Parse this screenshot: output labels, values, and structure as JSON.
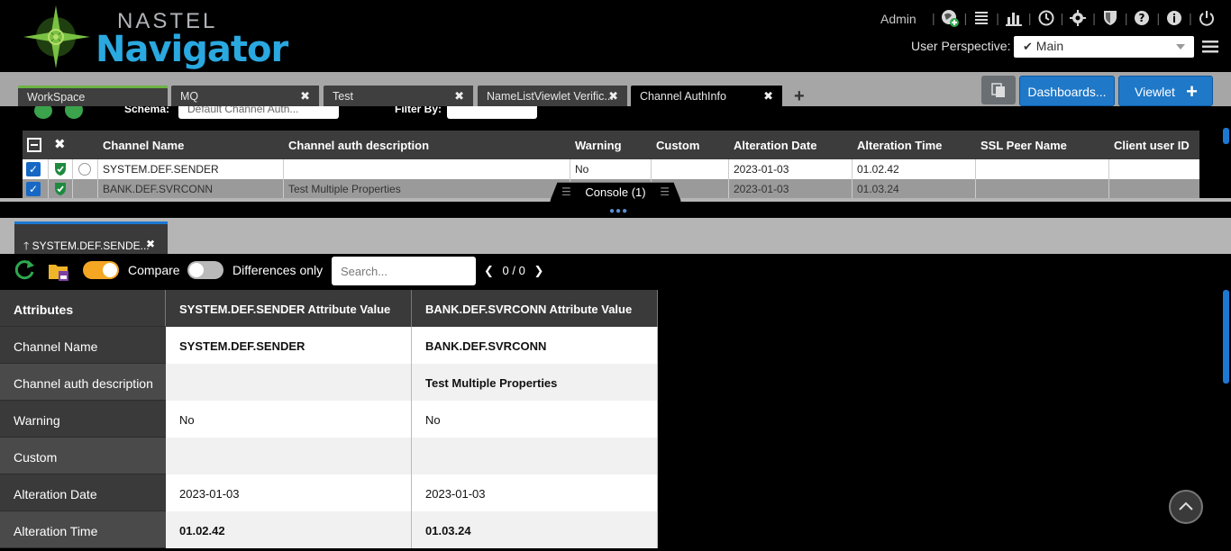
{
  "header": {
    "logo_top": "NASTEL",
    "logo_bottom": "Navigator",
    "user": "Admin",
    "perspective_label": "User Perspective:",
    "perspective_value": "Main",
    "icons": [
      "globe-add-icon",
      "list-icon",
      "bar-chart-icon",
      "clock-icon",
      "gear-icon",
      "shield-icon",
      "help-icon",
      "info-icon",
      "power-icon"
    ]
  },
  "tabs": [
    {
      "label": "WorkSpace"
    },
    {
      "label": "MQ"
    },
    {
      "label": "Test"
    },
    {
      "label": "NameListViewlet Verific..."
    },
    {
      "label": "Channel AuthInfo"
    }
  ],
  "toolbar_buttons": {
    "dashboards": "Dashboards...",
    "viewlet": "Viewlet"
  },
  "upper_toolbar": {
    "schema_label": "Schema:",
    "schema_value": "Default Channel Auth...",
    "filter_label": "Filter By:"
  },
  "grid": {
    "columns": [
      "Channel Name",
      "Channel auth description",
      "Warning",
      "Custom",
      "Alteration Date",
      "Alteration Time",
      "SSL Peer Name",
      "Client user ID"
    ],
    "rows": [
      {
        "channel_name": "SYSTEM.DEF.SENDER",
        "description": "",
        "warning": "No",
        "custom": "",
        "alt_date": "2023-01-03",
        "alt_time": "01.02.42",
        "ssl_peer": "",
        "client_user": ""
      },
      {
        "channel_name": "BANK.DEF.SVRCONN",
        "description": "Test Multiple Properties",
        "warning": "",
        "custom": "",
        "alt_date": "2023-01-03",
        "alt_time": "01.03.24",
        "ssl_peer": "",
        "client_user": ""
      }
    ]
  },
  "console": {
    "label": "Console (1)"
  },
  "compare": {
    "tab_label": "SYSTEM.DEF.SENDE...",
    "compare_label": "Compare",
    "diff_label": "Differences only",
    "search_placeholder": "Search...",
    "pager": "0 / 0",
    "headers": [
      "Attributes",
      "SYSTEM.DEF.SENDER Attribute Value",
      "BANK.DEF.SVRCONN Attribute Value"
    ],
    "rows": [
      {
        "attr": "Channel Name",
        "v1": "SYSTEM.DEF.SENDER",
        "v2": "BANK.DEF.SVRCONN",
        "diff": true
      },
      {
        "attr": "Channel auth description",
        "v1": "",
        "v2": "Test Multiple Properties",
        "diff": true
      },
      {
        "attr": "Warning",
        "v1": "No",
        "v2": "No",
        "diff": false
      },
      {
        "attr": "Custom",
        "v1": "",
        "v2": "",
        "diff": false
      },
      {
        "attr": "Alteration Date",
        "v1": "2023-01-03",
        "v2": "2023-01-03",
        "diff": false
      },
      {
        "attr": "Alteration Time",
        "v1": "01.02.42",
        "v2": "01.03.24",
        "diff": true
      }
    ]
  },
  "colors": {
    "accent": "#1f78c8",
    "diff_red": "#e11d1d",
    "toggle_on": "#f5a623"
  }
}
